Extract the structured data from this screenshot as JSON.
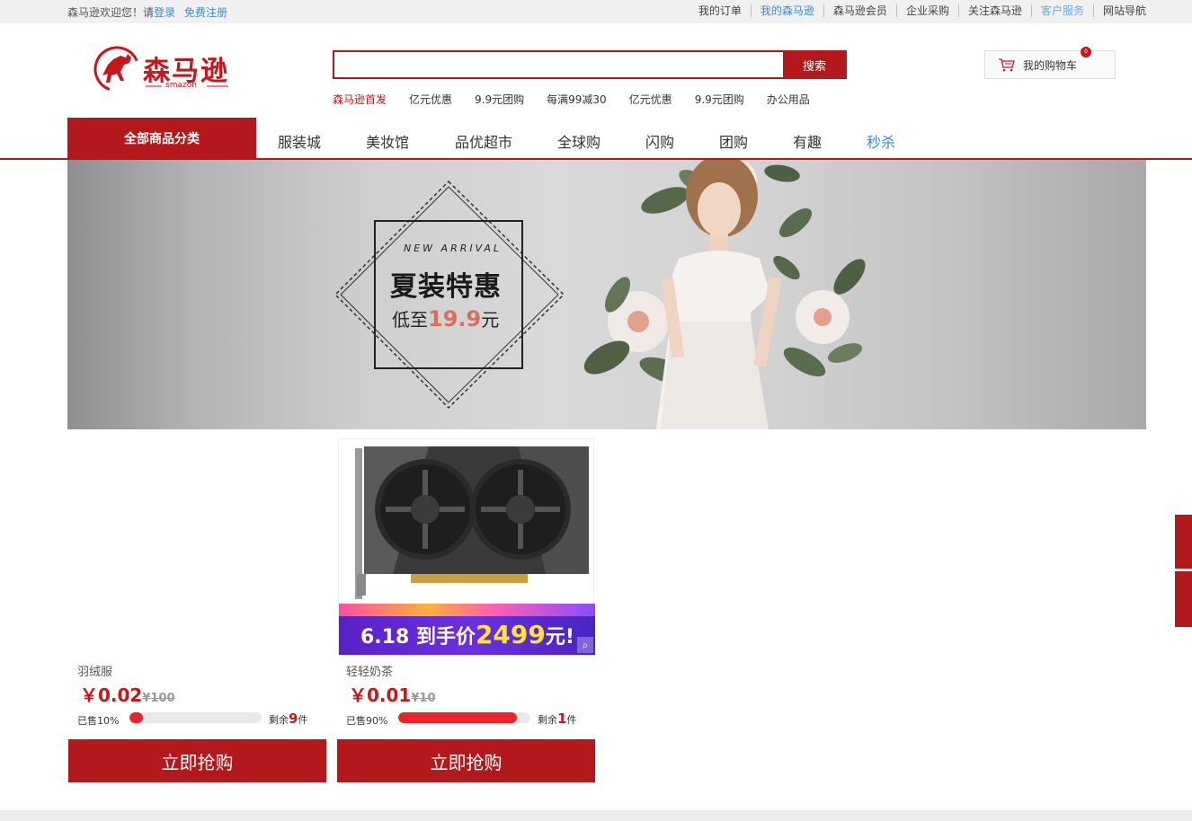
{
  "topbar": {
    "welcome": "森马逊欢迎您！请",
    "login": "登录",
    "register": "免费注册",
    "links": [
      {
        "label": "我的订单",
        "style": "normal"
      },
      {
        "label": "我的森马逊",
        "style": "blue"
      },
      {
        "label": "森马逊会员",
        "style": "normal"
      },
      {
        "label": "企业采购",
        "style": "normal"
      },
      {
        "label": "关注森马逊",
        "style": "normal"
      },
      {
        "label": "客户服务",
        "style": "lightblue"
      },
      {
        "label": "网站导航",
        "style": "normal"
      }
    ]
  },
  "logo": {
    "name": "森马逊",
    "sub": "smazon"
  },
  "search": {
    "value": "",
    "placeholder": "",
    "button": "搜索"
  },
  "hotwords": [
    "森马逊首发",
    "亿元优惠",
    "9.9元团购",
    "每满99减30",
    "亿元优惠",
    "9.9元团购",
    "办公用品"
  ],
  "cart": {
    "label": "我的购物车",
    "count": "0"
  },
  "nav": {
    "all_categories": "全部商品分类",
    "items": [
      "服装城",
      "美妆馆",
      "品优超市",
      "全球购",
      "闪购",
      "团购",
      "有趣",
      "秒杀"
    ],
    "active_index": 7
  },
  "banner": {
    "deco_text": "NEW ARRIVAL",
    "title": "夏装特惠",
    "sub_prefix": "低至",
    "sub_price": "19.9",
    "sub_unit": "元"
  },
  "products": [
    {
      "name": "羽绒服",
      "price": "￥0.02",
      "old_price": "¥100",
      "sold_label": "已售10%",
      "sold_fraction": 0.1,
      "remain_prefix": "剩余",
      "remain_count": "9",
      "remain_unit": "件",
      "buy": "立即抢购",
      "image": "none"
    },
    {
      "name": "轻轻奶茶",
      "price": "￥0.01",
      "old_price": "¥10",
      "sold_label": "已售90%",
      "sold_fraction": 0.9,
      "remain_prefix": "剩余",
      "remain_count": "1",
      "remain_unit": "件",
      "buy": "立即抢购",
      "image": "graphics-card",
      "badge": {
        "prefix": "6.18 到手价",
        "price": "2499",
        "suffix": "元!"
      }
    }
  ],
  "colors": {
    "brand_red": "#b3181c",
    "link_blue": "#3a8ad0",
    "price_red": "#c8161d"
  }
}
